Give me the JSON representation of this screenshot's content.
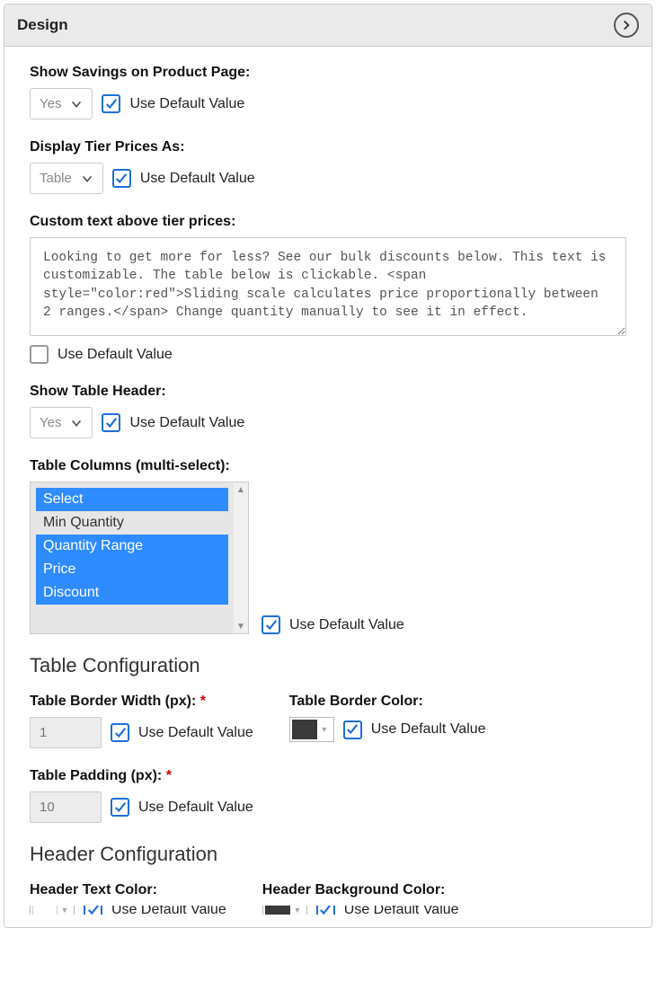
{
  "panel": {
    "title": "Design"
  },
  "udv_label": "Use Default Value",
  "fields": {
    "show_savings": {
      "label": "Show Savings on Product Page:",
      "value": "Yes"
    },
    "display_tier_as": {
      "label": "Display Tier Prices As:",
      "value": "Table"
    },
    "custom_text": {
      "label": "Custom text above tier prices:",
      "value": "Looking to get more for less? See our bulk discounts below. This text is customizable. The table below is clickable. <span style=\"color:red\">Sliding scale calculates price proportionally between 2 ranges.</span> Change quantity manually to see it in effect."
    },
    "show_table_header": {
      "label": "Show Table Header:",
      "value": "Yes"
    },
    "table_columns": {
      "label": "Table Columns (multi-select):",
      "options": [
        {
          "label": "Select",
          "selected": true
        },
        {
          "label": "Min Quantity",
          "selected": false
        },
        {
          "label": "Quantity Range",
          "selected": true
        },
        {
          "label": "Price",
          "selected": true
        },
        {
          "label": "Discount",
          "selected": true
        }
      ]
    }
  },
  "sections": {
    "table_config": {
      "heading": "Table Configuration",
      "border_width": {
        "label": "Table Border Width (px):",
        "value": "1",
        "required": true
      },
      "border_color": {
        "label": "Table Border Color:",
        "value": "#3a3a3a"
      },
      "padding": {
        "label": "Table Padding (px):",
        "value": "10",
        "required": true
      }
    },
    "header_config": {
      "heading": "Header Configuration",
      "text_color": {
        "label": "Header Text Color:",
        "value": "#ffffff"
      },
      "bg_color": {
        "label": "Header Background Color:",
        "value": "#3a3a3a"
      }
    }
  }
}
